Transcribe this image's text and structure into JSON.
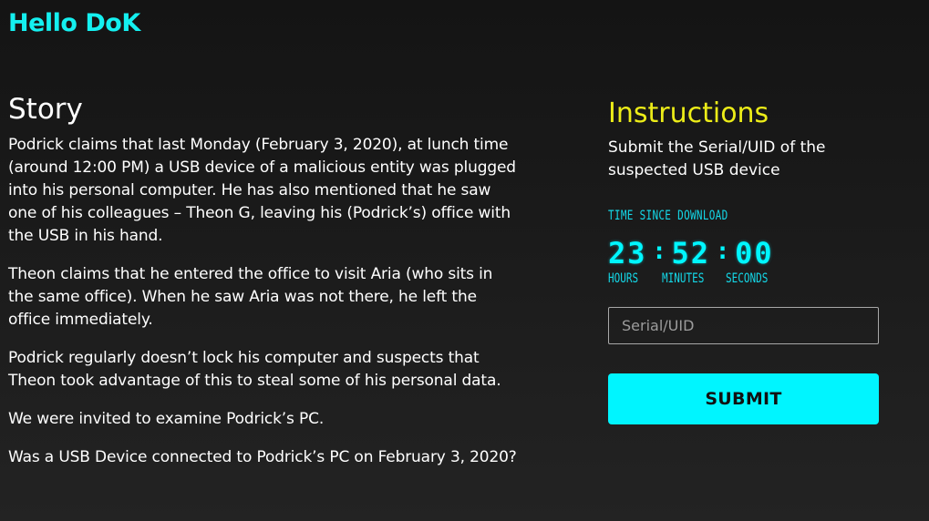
{
  "header": {
    "greeting": "Hello DoK"
  },
  "story": {
    "title": "Story",
    "paragraphs": [
      "Podrick claims that last Monday (February 3, 2020), at lunch time (around 12:00 PM) a USB device of a malicious entity was plugged into his personal computer. He has also mentioned that he saw one of his colleagues – Theon G, leaving his (Podrick’s) office with the USB in his hand.",
      "Theon claims that he entered the office to visit Aria (who sits in the same office). When he saw Aria was not there, he left the office immediately.",
      "Podrick regularly doesn’t lock his computer and suspects that Theon took advantage of this to steal some of his personal data.",
      "We were invited to examine Podrick’s PC.",
      "Was a USB Device connected to Podrick’s PC on February 3, 2020?"
    ]
  },
  "instructions": {
    "title": "Instructions",
    "description": "Submit the Serial/UID of the suspected USB device"
  },
  "timer": {
    "label": "TIME SINCE DOWNLOAD",
    "hours": "23",
    "minutes": "52",
    "seconds": "00",
    "separator": ":",
    "units": {
      "hours": "HOURS",
      "minutes": "MINUTES",
      "seconds": "SECONDS"
    }
  },
  "form": {
    "serial_placeholder": "Serial/UID",
    "serial_value": "",
    "submit_label": "SUBMIT"
  },
  "colors": {
    "accent_cyan": "#00f5ff",
    "title_yellow": "#ecec18",
    "background": "#1a1a1a"
  }
}
